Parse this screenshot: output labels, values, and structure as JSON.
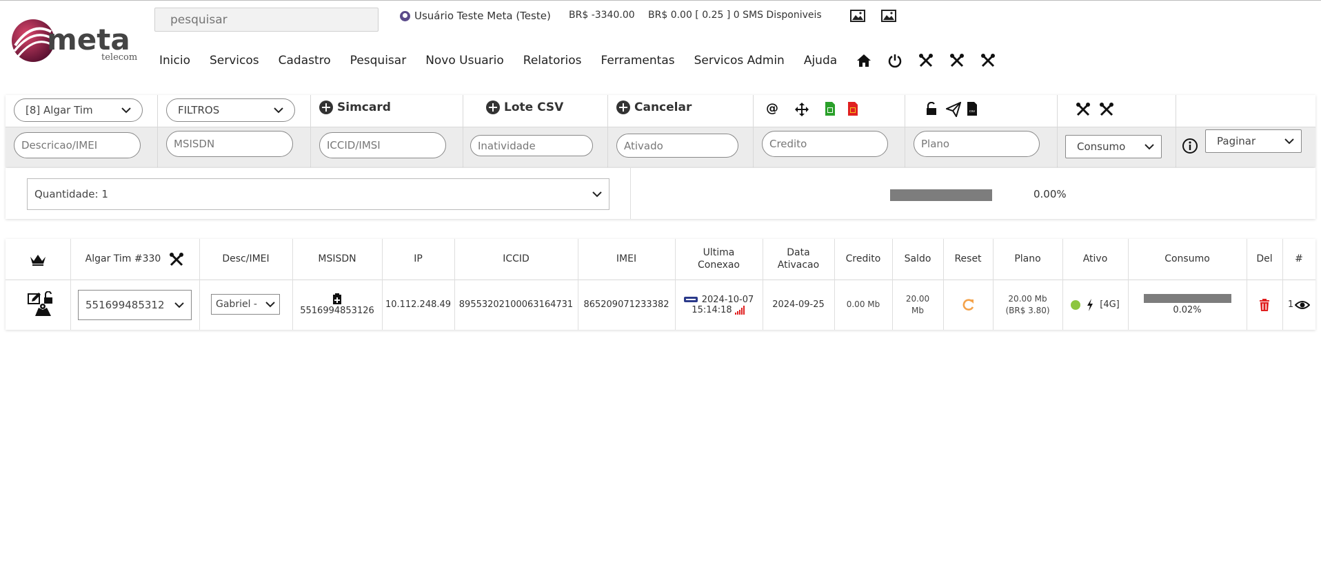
{
  "header": {
    "logo_text": "meta",
    "logo_sub": "telecom",
    "search_placeholder": "pesquisar",
    "user": "Usuário Teste Meta (Teste)",
    "balance": "BR$ -3340.00",
    "sms": "BR$ 0.00 [ 0.25 ] 0 SMS Disponiveis"
  },
  "nav": {
    "items": [
      "Inicio",
      "Servicos",
      "Cadastro",
      "Pesquisar",
      "Novo Usuario",
      "Relatorios",
      "Ferramentas",
      "Servicos Admin",
      "Ajuda"
    ]
  },
  "filters": {
    "operator": "[8] Algar Tim",
    "filtros": "FILTROS",
    "add_simcard": "Simcard",
    "add_lote": "Lote CSV",
    "add_cancelar": "Cancelar",
    "at_symbol": "@",
    "csv_label": "csv",
    "placeholders": {
      "descricao": "Descricao/IMEI",
      "msisdn": "MSISDN",
      "iccid": "ICCID/IMSI",
      "inatividade": "Inatividade",
      "ativado": "Ativado",
      "credito": "Credito",
      "plano": "Plano"
    },
    "consumo": "Consumo",
    "paginar": "Paginar"
  },
  "quantity": {
    "label": "Quantidade: 1",
    "progress_pct": 0,
    "progress_text": "0.00%"
  },
  "table": {
    "headers": {
      "operator": "Algar Tim #330",
      "desc": "Desc/IMEI",
      "msisdn": "MSISDN",
      "ip": "IP",
      "iccid": "ICCID",
      "imei": "IMEI",
      "ultima_1": "Ultima",
      "ultima_2": "Conexao",
      "data_1": "Data",
      "data_2": "Ativacao",
      "credito": "Credito",
      "saldo": "Saldo",
      "reset": "Reset",
      "plano": "Plano",
      "ativo": "Ativo",
      "consumo": "Consumo",
      "del": "Del",
      "hash": "#"
    },
    "row": {
      "line_select": "551699485312",
      "desc_select": "Gabriel -",
      "msisdn": "5516994853126",
      "ip": "10.112.248.49",
      "iccid": "89553202100063164731",
      "imei": "865209071233382",
      "ultima_date": "2024-10-07",
      "ultima_time": "15:14:18",
      "data_ativacao": "2024-09-25",
      "credito": "0.00 Mb",
      "saldo_1": "20.00",
      "saldo_2": "Mb",
      "plano_1": "20.00 Mb",
      "plano_2": "(BR$ 3.80)",
      "tech": "[4G]",
      "consumo_pct": 0.02,
      "consumo_text": "0.02%",
      "index": "1"
    }
  },
  "colors": {
    "logo_red": "#9a1b3a",
    "progress": "#7d7d7d",
    "active_dot": "#8dc63f",
    "reset_orange": "#f4a24a",
    "delete_red": "#e02020",
    "signal_red": "#e02020",
    "chart_blue": "#1aa3d9"
  }
}
